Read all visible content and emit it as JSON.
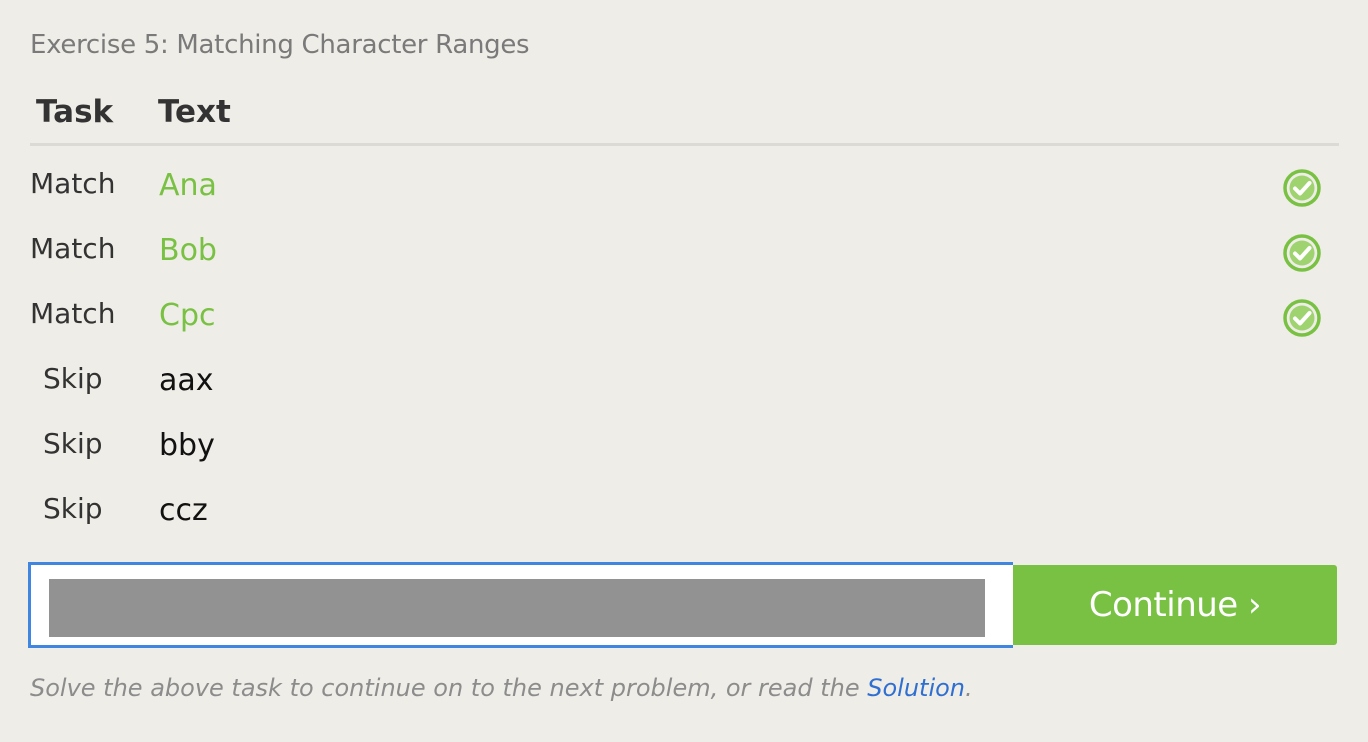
{
  "exercise": {
    "title": "Exercise 5: Matching Character Ranges"
  },
  "table": {
    "headers": {
      "task": "Task",
      "text": "Text"
    },
    "rows": [
      {
        "task": "Match",
        "text": "Ana",
        "passed": true
      },
      {
        "task": "Match",
        "text": "Bob",
        "passed": true
      },
      {
        "task": "Match",
        "text": "Cpc",
        "passed": true
      },
      {
        "task": "Skip",
        "text": "aax",
        "passed": false
      },
      {
        "task": "Skip",
        "text": "bby",
        "passed": false
      },
      {
        "task": "Skip",
        "text": "ccz",
        "passed": false
      }
    ]
  },
  "answer": {
    "value": "",
    "placeholder": ""
  },
  "continue_button": {
    "label": "Continue ›"
  },
  "hint": {
    "prefix": "Solve the above task to continue on to the next problem, or read the ",
    "link_text": "Solution",
    "suffix": "."
  },
  "colors": {
    "success": "#79c143",
    "focus_border": "#3f86e1",
    "link": "#2f6fd1",
    "background": "#efede7"
  },
  "icons": {
    "status": "check-circle-icon"
  }
}
